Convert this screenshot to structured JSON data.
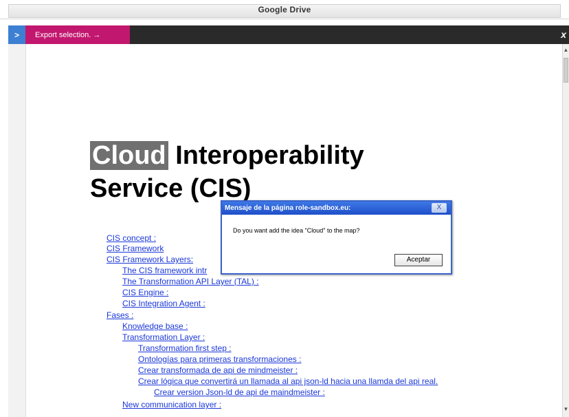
{
  "window": {
    "title": "Google Drive"
  },
  "toolbar": {
    "toggle_label": ">",
    "export_label": "Export selection. →",
    "close_label": "x",
    "accent_color": "#c2176f",
    "toggle_color": "#3d7fd2"
  },
  "document": {
    "highlight_word": "Cloud",
    "title_rest_line1": " Interoperability",
    "title_line2": "Service (CIS)",
    "toc": [
      "CIS concept :",
      "CIS Framework",
      "CIS Framework Layers:",
      "The CIS framework intr",
      "The Transformation API Layer (TAL) :",
      "CIS Engine :",
      "CIS Integration Agent :",
      "Fases :",
      "Knowledge base :",
      "Transformation Layer :",
      "Transformation first step :",
      "Ontologías para primeras transformaciones :",
      "Crear transformada de api de mindmeister :",
      "Crear lógica que convertirá un llamada al api json-ld hacia una llamda del api real.",
      "Crear version Json-ld de api de maindmeister :",
      "New communication layer :"
    ]
  },
  "dialog": {
    "title": "Mensaje de la página role-sandbox.eu:",
    "message": "Do you want add the idea \"Cloud\" to the map?",
    "ok_label": "Aceptar",
    "close_label": "X"
  },
  "scrollbar": {
    "up": "▲",
    "down": "▼"
  }
}
